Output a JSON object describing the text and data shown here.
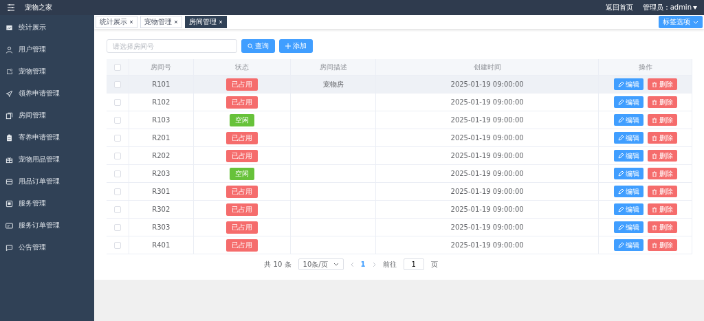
{
  "header": {
    "title": "宠物之家",
    "links": [
      "返回首页"
    ],
    "user": "管理员：admin"
  },
  "sidebar": {
    "items": [
      {
        "label": "统计展示"
      },
      {
        "label": "用户管理"
      },
      {
        "label": "宠物管理"
      },
      {
        "label": "领养申请管理"
      },
      {
        "label": "房间管理"
      },
      {
        "label": "寄养申请管理"
      },
      {
        "label": "宠物用品管理"
      },
      {
        "label": "用品订单管理"
      },
      {
        "label": "服务管理"
      },
      {
        "label": "服务订单管理"
      },
      {
        "label": "公告管理"
      }
    ]
  },
  "tabs": [
    {
      "label": "统计展示",
      "selected": false
    },
    {
      "label": "宠物管理",
      "selected": false
    },
    {
      "label": "房间管理",
      "selected": true
    }
  ],
  "tab_options": "标签选项",
  "search": {
    "placeholder": "请选择房间号"
  },
  "buttons": [
    {
      "label": "查询",
      "kind": "search"
    },
    {
      "label": "添加",
      "kind": "add"
    }
  ],
  "table": {
    "columns": [
      "房间号",
      "状态",
      "房间描述",
      "创建时间",
      "操作"
    ],
    "all_checked": false,
    "rows": [
      {
        "checked": false,
        "room": "R101",
        "status": "已占用",
        "kind": "occupied",
        "description": "宠物房",
        "created": "2025-01-19 09:00:00",
        "hovered": true,
        "actions": [
          "编辑",
          "删除"
        ]
      },
      {
        "checked": false,
        "room": "R102",
        "status": "已占用",
        "kind": "occupied",
        "created": "2025-01-19 09:00:00",
        "hovered": false,
        "actions": [
          "编辑",
          "删除"
        ]
      },
      {
        "checked": false,
        "room": "R103",
        "status": "空闲",
        "kind": "free",
        "created": "2025-01-19 09:00:00",
        "hovered": false,
        "actions": [
          "编辑",
          "删除"
        ]
      },
      {
        "checked": false,
        "room": "R201",
        "status": "已占用",
        "kind": "occupied",
        "created": "2025-01-19 09:00:00",
        "hovered": false,
        "actions": [
          "编辑",
          "删除"
        ]
      },
      {
        "checked": false,
        "room": "R202",
        "status": "已占用",
        "kind": "occupied",
        "created": "2025-01-19 09:00:00",
        "hovered": false,
        "actions": [
          "编辑",
          "删除"
        ]
      },
      {
        "checked": false,
        "room": "R203",
        "status": "空闲",
        "kind": "free",
        "created": "2025-01-19 09:00:00",
        "hovered": false,
        "actions": [
          "编辑",
          "删除"
        ]
      },
      {
        "checked": false,
        "room": "R301",
        "status": "已占用",
        "kind": "occupied",
        "created": "2025-01-19 09:00:00",
        "hovered": false,
        "actions": [
          "编辑",
          "删除"
        ]
      },
      {
        "checked": false,
        "room": "R302",
        "status": "已占用",
        "kind": "occupied",
        "created": "2025-01-19 09:00:00",
        "hovered": false,
        "actions": [
          "编辑",
          "删除"
        ]
      },
      {
        "checked": false,
        "room": "R303",
        "status": "已占用",
        "kind": "occupied",
        "created": "2025-01-19 09:00:00",
        "hovered": false,
        "actions": [
          "编辑",
          "删除"
        ]
      },
      {
        "checked": false,
        "room": "R401",
        "status": "已占用",
        "kind": "occupied",
        "created": "2025-01-19 09:00:00",
        "hovered": false,
        "actions": [
          "编辑",
          "删除"
        ]
      }
    ]
  },
  "pagination": {
    "total": "共 10 条",
    "page_size": "10条/页",
    "current": "1",
    "goto_label": "前往",
    "goto_value": "1",
    "page_suffix": "页"
  }
}
